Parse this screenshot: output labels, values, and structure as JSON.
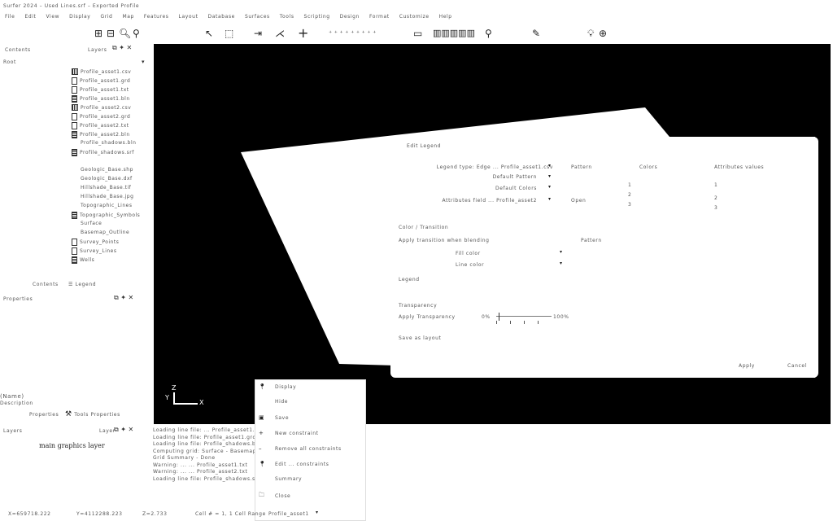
{
  "window": {
    "title": "Surfer 2024 – Used Lines.srf – Exported Profile"
  },
  "menu": [
    "File",
    "Edit",
    "View",
    "Display",
    "Grid",
    "Map",
    "Features",
    "Layout",
    "Database",
    "Surfaces",
    "Tools",
    "Scripting",
    "Design",
    "Format",
    "Customize",
    "Help"
  ],
  "toolbar": {
    "icons": [
      "zoom-extents-icon",
      "zoom-out-icon",
      "zoom-in-icon",
      "zoom-window-icon",
      "select-icon",
      "rect-select-icon",
      "arrow-icon",
      "line-icon",
      "crosshair-icon",
      "grid-icon",
      "point-icon",
      "frame-icon",
      "color-bars-icon",
      "magnifier-icon",
      "pen-icon",
      "light-icon",
      "globe-icon"
    ]
  },
  "contents_panel": {
    "header": "Contents",
    "header_right": "Layers",
    "root": "Root",
    "items": [
      {
        "icon": "grid",
        "label": "Profile_asset1.csv"
      },
      {
        "icon": "doc",
        "label": "Profile_asset1.grd"
      },
      {
        "icon": "doc",
        "label": "Profile_asset1.txt"
      },
      {
        "icon": "list",
        "label": "Profile_asset1.bln"
      },
      {
        "icon": "grid",
        "label": "Profile_asset2.csv"
      },
      {
        "icon": "doc",
        "label": "Profile_asset2.grd"
      },
      {
        "icon": "doc",
        "label": "Profile_asset2.txt"
      },
      {
        "icon": "list",
        "label": "Profile_asset2.bln"
      },
      {
        "icon": "",
        "label": "Profile_shadows.bln"
      },
      {
        "icon": "list",
        "label": "Profile_shadows.srf"
      },
      {
        "icon": "",
        "label": ""
      },
      {
        "icon": "",
        "label": "Geologic_Base.shp"
      },
      {
        "icon": "",
        "label": "Geologic_Base.dxf"
      },
      {
        "icon": "",
        "label": "Hillshade_Base.tif"
      },
      {
        "icon": "",
        "label": "Hillshade_Base.jpg"
      },
      {
        "icon": "",
        "label": "Topographic_Lines"
      },
      {
        "icon": "list",
        "label": "Topographic_Symbols"
      },
      {
        "icon": "",
        "label": "Surface"
      },
      {
        "icon": "",
        "label": "Basemap_Outline"
      },
      {
        "icon": "doc",
        "label": "Survey_Points"
      },
      {
        "icon": "doc",
        "label": "Survey_Lines"
      },
      {
        "icon": "list",
        "label": "Wells"
      }
    ],
    "tabs": [
      "Contents",
      "Legend"
    ]
  },
  "properties_panel": {
    "header": "Properties",
    "name_label": "(Name)",
    "desc_label": "Description",
    "tabs": [
      "Properties",
      "Tools Properties"
    ]
  },
  "layers_panel": {
    "header": "Layers",
    "header_right": "Layer",
    "layer_name": "main graphics layer"
  },
  "log": [
    "Loading line file: ... Profile_asset1.bln",
    "Loading line file: Profile_asset1.grd",
    "Loading line file: Profile_shadows.bln",
    "Computing grid: Surface - Basemap",
    "Grid Summary - Done",
    "Warning: ... ... Profile_asset1.txt",
    "Warning: ... ... Profile_asset2.txt",
    "Loading line file: Profile_shadows.srf"
  ],
  "legend_dialog": {
    "title": "Edit Legend",
    "rows": [
      {
        "label": "Legend type: Edge ... Profile_asset1.csv",
        "dropdown": true,
        "col2": "Pattern",
        "col3": "Colors",
        "col4": "Attributes values"
      },
      {
        "label": "Default Pattern",
        "dropdown": true,
        "col2": "",
        "col3": "",
        "col4": ""
      },
      {
        "label": "Default Colors",
        "dropdown": true,
        "col2": "",
        "col3": "",
        "col4": ""
      },
      {
        "label": "Attributes field ... Profile_asset2",
        "dropdown": true,
        "col2": "Open",
        "col3": "",
        "col4": ""
      }
    ],
    "color_values": [
      "1",
      "2",
      "3"
    ],
    "attr_values": [
      "1",
      "2",
      "3"
    ],
    "section_label": "Color / Transition",
    "section_text": "Apply transition when blending",
    "section_right": "Pattern",
    "sub1": "Fill color",
    "sub2": "Line color",
    "legend_label": "Legend",
    "transparency_label": "Transparency",
    "transparency_text": "Apply Transparency",
    "slider_min": "0%",
    "slider_max": "100%",
    "slider_value": 0.05,
    "save_label": "Save as layout",
    "apply_button": "Apply",
    "close_button": "Cancel"
  },
  "context_menu": [
    {
      "icon": "pin",
      "label": "Display"
    },
    {
      "icon": "",
      "label": "Hide"
    },
    {
      "icon": "save",
      "label": "Save"
    },
    {
      "icon": "plus",
      "label": "New constraint"
    },
    {
      "icon": "minus",
      "label": "Remove all constraints"
    },
    {
      "icon": "pin",
      "label": "Edit ... constraints"
    },
    {
      "icon": "",
      "label": "Summary"
    },
    {
      "icon": "close",
      "label": "Close"
    }
  ],
  "statusbar": {
    "x": "X=659718.222",
    "y": "Y=4112288.223",
    "z": "Z=2.733",
    "cells": "Cell # = 1, 1 Cell Range",
    "layer": "Profile_asset1"
  },
  "axes": {
    "z": "Z",
    "y": "Y",
    "x": "X"
  }
}
